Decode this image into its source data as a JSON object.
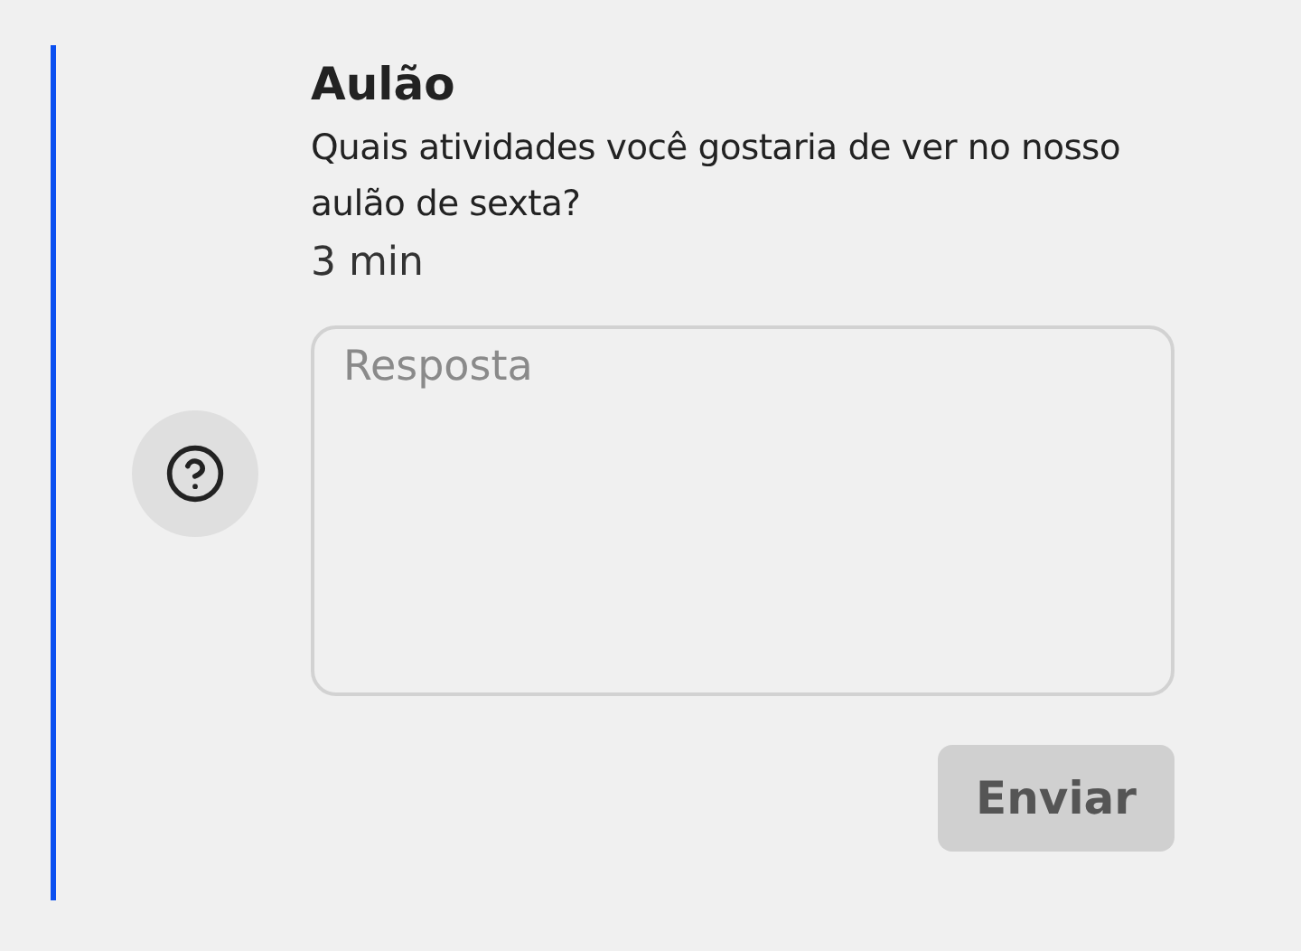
{
  "post": {
    "title": "Aulão",
    "question": "Quais atividades você gostaria de ver no nosso aulão de sexta?",
    "time": "3 min"
  },
  "answer": {
    "placeholder": "Resposta"
  },
  "submit": {
    "label": "Enviar",
    "disabled": true
  }
}
